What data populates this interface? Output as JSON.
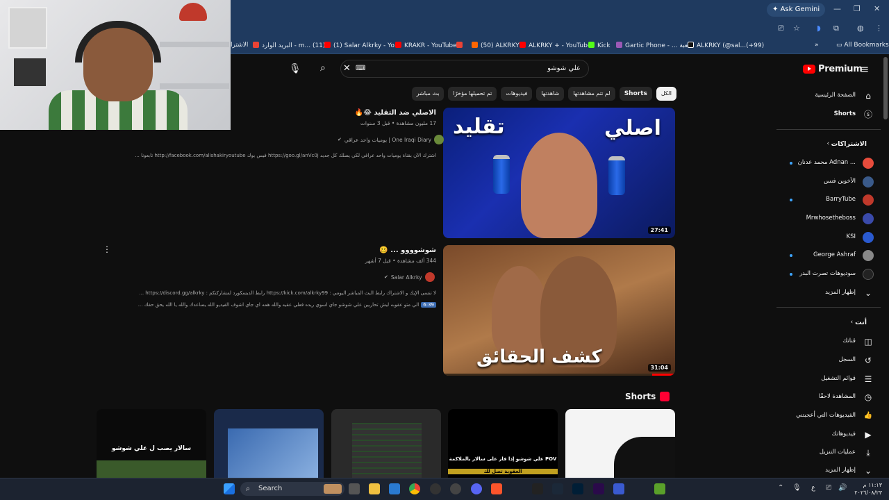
{
  "browser": {
    "ask_gemini": "Ask Gemini",
    "bookmarks": [
      {
        "label": "الاشترا",
        "color": "#ff0000"
      },
      {
        "label": "البريد الوارد - m... (11)",
        "color": "#ea4335"
      },
      {
        "label": "(1) Salar Alkrky - Yo...",
        "color": "#ff0000"
      },
      {
        "label": "KRAKR - YouTube",
        "color": "#ff0000"
      },
      {
        "label": "(50) ALKRKY",
        "color": "#ff6600"
      },
      {
        "label": "ALKRKY + - YouTube",
        "color": "#ff0000"
      },
      {
        "label": "Kick",
        "color": "#53fc18"
      },
      {
        "label": "Gartic Phone - ... لعبة",
        "color": "#9b59b6"
      },
      {
        "label": "ALKRKY (@sal...(+99)",
        "color": "#111111"
      }
    ],
    "all_bookmarks": "All Bookmarks"
  },
  "youtube": {
    "logo": "Premium",
    "search_value": "علي شوشو",
    "chips": [
      "الكل",
      "Shorts",
      "لم تتم مشاهدتها",
      "شاهدتها",
      "فيديوهات",
      "تم تحميلها مؤخرًا",
      "بث مباشر"
    ],
    "videos": [
      {
        "title": "الاصلي ضد التقليد 😂🔥",
        "meta": "17 مليون مشاهدة • قبل 3 سنوات",
        "channel": "يوميات واحد عراقي | One Iraqi Diary",
        "desc": "اشترك الآن بقناة يوميات واحد عراقي لكي يصلك كل جديد https://goo.gl/anVc0j فيس بوك http://facebook.com/alishakiryoutube تابعونا ...",
        "duration": "27:41",
        "thumb_left": "تقليد",
        "thumb_right": "اصلي"
      },
      {
        "title": "شوشوووو ... 🥴",
        "meta": "344 ألف مشاهدة • قبل 7 أشهر",
        "channel": "Salar Alkrky",
        "desc1": "لا تنسى الإيك و الاشتراك رابط البث المباشر اليومي : https://kick.com/alkrky99 رابط الديسكورد لمشاركتكم : https://discord.gg/alkrky ...",
        "desc2_badge": "6:39",
        "desc2": "الي متو عقوبه ليش تحاربين علي شوشو جاي اسوي ريده فعلي عقيه والله همه اي جاي اشوف الفيديو الله يساعدك والله يا الله يحق حقك ...",
        "duration": "31:04",
        "thumb_text": "كشف الحقائق"
      }
    ],
    "shorts_heading": "Shorts",
    "shorts": [
      {
        "caption": "سالار يصب ل علي شوشو"
      },
      {
        "caption": ""
      },
      {
        "caption": ""
      },
      {
        "caption": "علي شوشو إذا فاز على سالار بالملاكمة POV",
        "sub": "العقوبة تصل لك"
      },
      {
        "caption": ""
      }
    ],
    "sidebar": {
      "home": "الصفحة الرئيسية",
      "shorts": "Shorts",
      "subs_heading": "الاشتراكات",
      "subs": [
        {
          "label": "محمد عدنان Adnan ...",
          "color": "#e74c3c",
          "dot": true
        },
        {
          "label": "الأخوين فنس",
          "color": "#3a5a8a",
          "dot": false
        },
        {
          "label": "BarryTube",
          "color": "#c0392b",
          "dot": true
        },
        {
          "label": "Mrwhosetheboss",
          "color": "#3a4aaa",
          "dot": false
        },
        {
          "label": "KSI",
          "color": "#2a5ad0",
          "dot": false
        },
        {
          "label": "George Ashraf",
          "color": "#888888",
          "dot": true
        },
        {
          "label": "سوديوهات تصرت البدر",
          "color": "#222222",
          "dot": true
        }
      ],
      "show_more": "إظهار المزيد",
      "you_heading": "أنت",
      "you": [
        {
          "label": "قناتك",
          "icon": "channel-icon",
          "glyph": "◫"
        },
        {
          "label": "السجل",
          "icon": "history-icon",
          "glyph": "↺"
        },
        {
          "label": "قوائم التشغيل",
          "icon": "playlists-icon",
          "glyph": "☰"
        },
        {
          "label": "المشاهدة لاحقًا",
          "icon": "watch-later-icon",
          "glyph": "◷"
        },
        {
          "label": "الفيديوهات التي أعجبتني",
          "icon": "like-icon",
          "glyph": "👍"
        },
        {
          "label": "فيديوهاتك",
          "icon": "your-videos-icon",
          "glyph": "▶"
        },
        {
          "label": "عمليات التنزيل",
          "icon": "download-icon",
          "glyph": "⤓"
        },
        {
          "label": "إظهار المزيد",
          "icon": "chevron-down-icon",
          "glyph": "⌄"
        }
      ]
    }
  },
  "taskbar": {
    "search": "Search",
    "time": "١١:١٣ م",
    "date": "٢٠٢٦/٠٨/٢٣",
    "lang": "ع"
  }
}
